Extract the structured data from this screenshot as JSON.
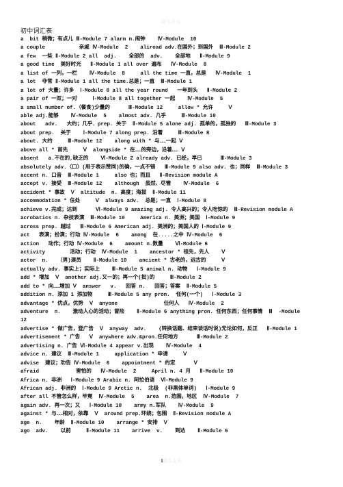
{
  "document": {
    "title": "初中词汇表",
    "watermark": "精品文档",
    "page_number": "1",
    "page_number_suffix": "精品文档"
  },
  "entries": [
    "a  bit 稍微；有点儿 Ⅲ-Module 7 alarm n.闹钟    Ⅳ-Module  10",
    "a couple           亲戚 Ⅳ-Module  2    aliroad adv.在国外；到国外  Ⅲ-Module 2",
    "a few  一些 Ⅱ-Module 2 all  adj.    全部的  adv.    全部地   Ⅱ-Module 9",
    "a good time  美好时光   Ⅱ-Module 1 all over 遍布   Ⅳ-Module  8",
    "a list of 一列，一栏    Ⅳ-Module  8     all the time 一直，总是   Ⅳ-Module  1",
    "a lot  非常 Ⅱ-Module 1 all the time.总是；一直  Ⅲ-Module 1",
    "a lot of 大量；许多  Ⅰ-Module 8 all the year round   一年到头   Ⅱ-Module 2",
    "a pair of 一双；一对     Ⅰ-Module 8 all together 一起    Ⅳ-Module  5",
    "a small number of.（餐食)少量的      Ⅲ-Module 12     allow * 允许     Ⅴ",
    "able adj.能够    Ⅳ-Module  5    almost adv. 几乎     Ⅲ-Module 10",
    "about   adv.   大约；几乎．prep. 关于  Ⅱ-Module 5 alone adj. 孤单的，孤独的   Ⅲ-Module 3",
    "about prep.  关于    Ⅰ-Module 7 along prep. 沿着     Ⅲ-Module 8",
    "about. 大约     Ⅲ-Module 12    along with * 与……一起 Ⅴ",
    "above all * 首先     Ⅴ  alongside * 在……的旁边，沿着…… Ⅴ",
    "absent   a.不在的,缺乏的    Ⅵ-Module 2 already adv. 已经，早已      Ⅲ-Module 3",
    "absolutely adv.〈口〉(用于表示赞同)的确，一点不错   Ⅲ-Module 9 also adv. 也；同样  Ⅲ-Module 3",
    "accent n. 口音  Ⅲ-Module 1     also 也；而且   Ⅱ-Revision module A",
    "accept v. 接受  Ⅲ-Module 12    although  虽然、尽管    Ⅳ-Module  6",
    "accident * 事故  Ⅴ  altitude  n. 高度；海拔  Ⅱ-Module 11",
    "accommodation * 住处     Ⅴ  always adv.  总是；一直  Ⅰ-Module 8",
    "achieve v.完成；达到      Ⅵ-Module 9 amazing adj. 令人高兴的；令人吃惊的  Ⅲ-Revision module A",
    "acrobatics n. 杂技表演  Ⅲ-Module 10     America n. 美洲；美国  Ⅰ-Module 9",
    "across prep. 越过   Ⅲ-Module 6 American adj. 美洲的；美国人的 Ⅰ-Module 9",
    "act   表演；扮演；行动 Ⅳ-Module  6    among  在.....之中 Ⅳ-Module  6",
    "action   动作；行动 Ⅳ-Module  6    amount n.数量    Ⅵ-Module 6",
    "activity        活动；行动  Ⅳ-Module  1    ancestor * 祖先，先人    Ⅴ",
    "actor  n.   （男)演员    Ⅱ-Module 10    ancient * 古老的，远古的     Ⅴ",
    "actually adv. 事实上；实际上    Ⅲ-Module 5 animal n. 动物   Ⅰ-Module 9",
    "add * 增加  Ⅴ  another adj.又一的；再一个(批)的     Ⅲ-Module 2",
    "add to * 向……增加 Ⅴ  answer   v.   回答 n.   回答；答案  Ⅱ-Module 5",
    "addition n. 添加 1 添加物     Ⅲ-Module 5 any pron.  任何(一个)   Ⅰ-Module 3",
    "advantage * 优点，优势  Ⅴ  anyone               任何人   Ⅳ-Module  2",
    "adventure  n.    激动人心的活动；冒险    Ⅱ-Module 6 anything pron. 任何东西；任何事情  Ⅲ  -Module",
    "12",
    "advertise * 做广告，登广告  Ⅴ  anyway  adv.    (转换话题、结束谈话时说)无论如何，反正   Ⅱ-Module 1",
    "advertisement * 广告   Ⅴ  anywhere adv.&pron.任何地方      Ⅲ-Module 2",
    "advertising n. 广告 Ⅵ-Module 4 appear v.出现    Ⅳ-Module  4",
    "advice n. 建议  Ⅲ-Module 1     application * 申请     Ⅴ",
    "advise  建议；劝告 Ⅳ-Module  6    appointment * 约定      Ⅴ",
    "afraid            害怕的   Ⅳ-Module  2     April n. 4 月   Ⅱ-Module 10",
    "Africa n. 非洲   Ⅰ-Module 9 Arabic n. 阿拉伯语  Ⅵ-Module 9",
    "African adj. 非洲的  Ⅰ-Module 9 Arctic n.  北极  (非黑体单词)   Ⅰ-Module 9",
    "after all 不管怎么样，毕竟  Ⅳ-Module  5    area  n.范围，地区  Ⅳ-Module  7",
    "again adv. 再一次；又   Ⅰ-Module 10    army n.军队    Ⅳ-Module  9",
    "against * 与……相对，依靠  Ⅴ  around prep.环绕；包围  Ⅱ-Revision module A",
    "age  n.    年龄  Ⅱ-Module 10    arrange * 安排  Ⅴ",
    "ago  adv.    以前     Ⅱ-Module 11    arrive  v.    到达    Ⅱ-Module 6"
  ]
}
